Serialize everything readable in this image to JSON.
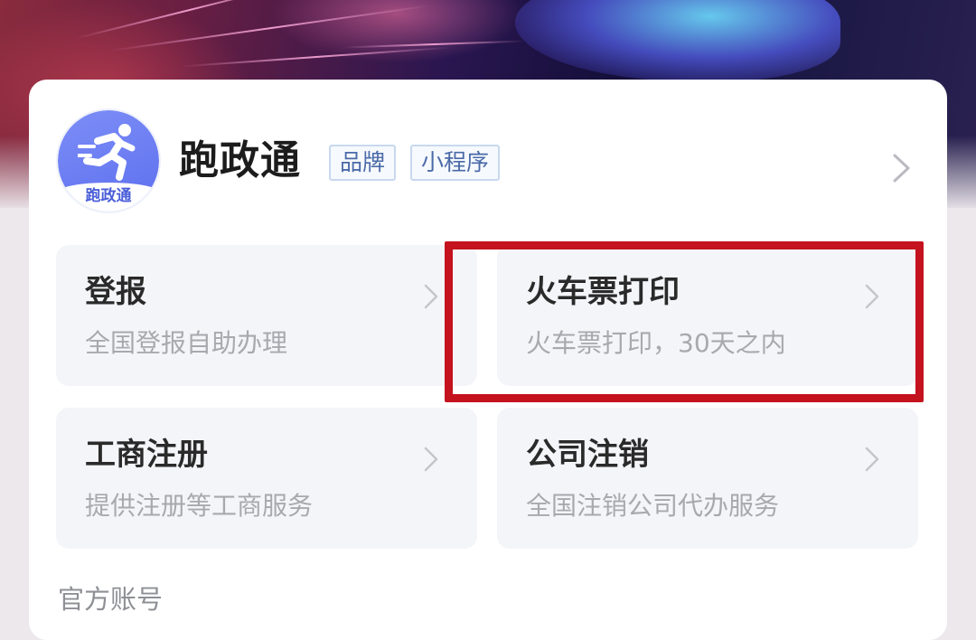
{
  "mini_program": {
    "name": "跑政通",
    "logo_text": "跑政通",
    "tags": [
      "品牌",
      "小程序"
    ]
  },
  "services": [
    {
      "title": "登报",
      "desc": "全国登报自助办理"
    },
    {
      "title": "火车票打印",
      "desc": "火车票打印，30天之内"
    },
    {
      "title": "工商注册",
      "desc": "提供注册等工商服务"
    },
    {
      "title": "公司注销",
      "desc": "全国注销公司代办服务"
    }
  ],
  "section_label": "官方账号",
  "highlighted_service": "火车票打印",
  "colors": {
    "highlight": "#c4121f",
    "logo": "#6676f1",
    "tag_text": "#4a6aa8"
  },
  "icons": [
    "runner-logo-icon",
    "chevron-right-icon"
  ]
}
